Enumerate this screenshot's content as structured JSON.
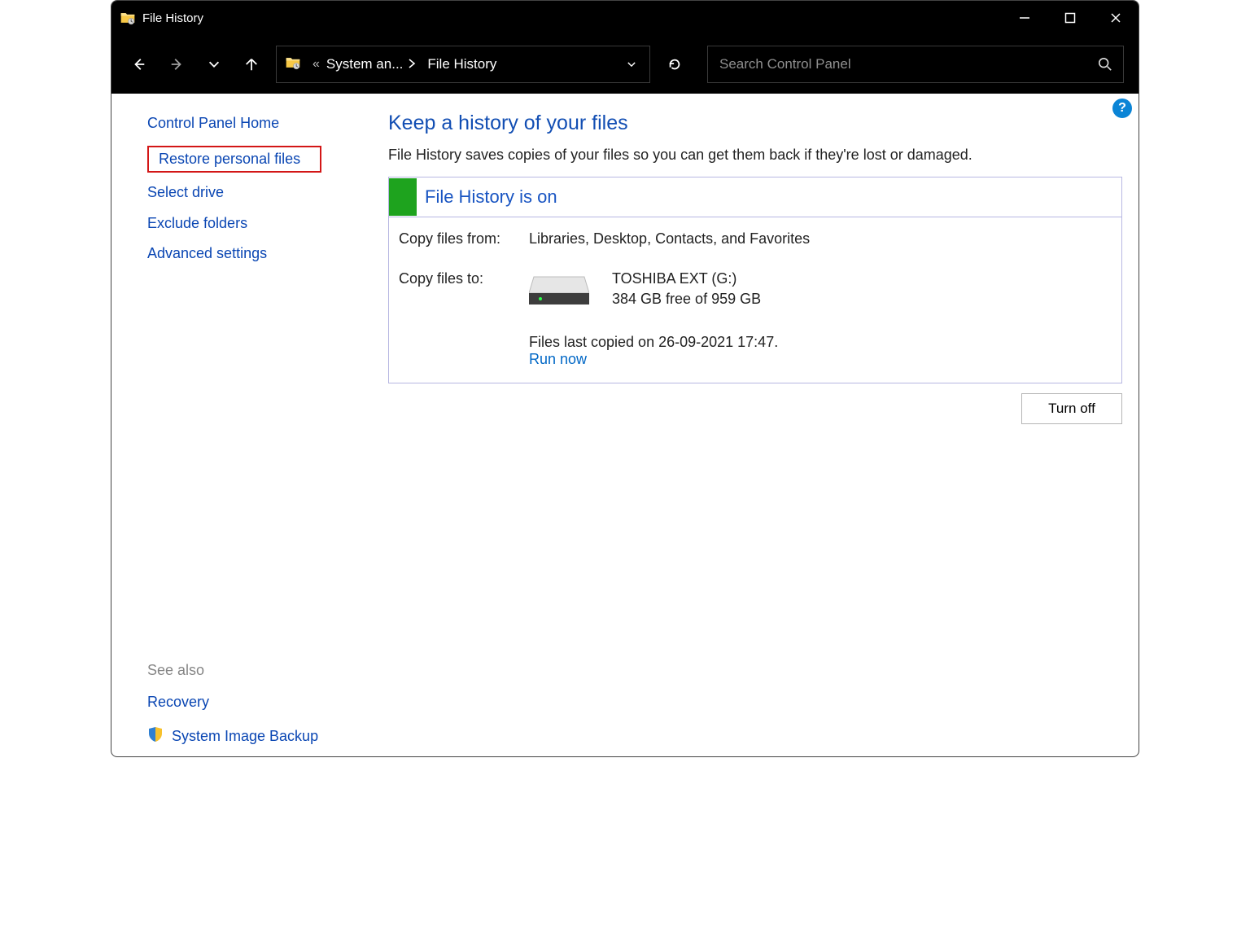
{
  "window": {
    "title": "File History"
  },
  "address": {
    "prefix_glyph": "«",
    "crumb1": "System an...",
    "crumb2": "File History"
  },
  "search": {
    "placeholder": "Search Control Panel"
  },
  "sidebar": {
    "home": "Control Panel Home",
    "restore": "Restore personal files",
    "select_drive": "Select drive",
    "exclude": "Exclude folders",
    "advanced": "Advanced settings",
    "see_also_label": "See also",
    "recovery": "Recovery",
    "sys_image_backup": "System Image Backup"
  },
  "content": {
    "heading": "Keep a history of your files",
    "description": "File History saves copies of your files so you can get them back if they're lost or damaged.",
    "status_title": "File History is on",
    "copy_from_label": "Copy files from:",
    "copy_from_value": "Libraries, Desktop, Contacts, and Favorites",
    "copy_to_label": "Copy files to:",
    "drive_name": "TOSHIBA EXT (G:)",
    "drive_space": "384 GB free of 959 GB",
    "last_copied": "Files last copied on 26-09-2021 17:47.",
    "run_now": "Run now",
    "turn_off": "Turn off"
  },
  "help_glyph": "?"
}
